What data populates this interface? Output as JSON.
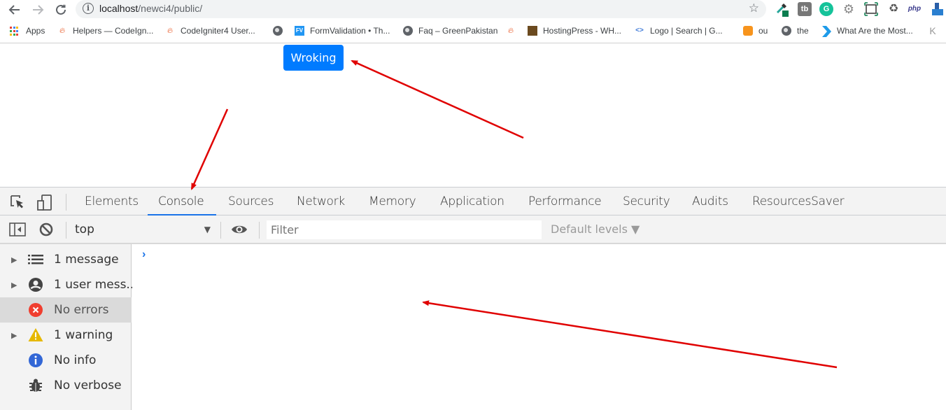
{
  "browser": {
    "url_host": "localhost",
    "url_path": "/newci4/public/",
    "nav": {
      "back": "back-icon",
      "forward": "forward-icon",
      "reload": "reload-icon"
    },
    "extensions": [
      "eyedropper-extension",
      "tb-extension",
      "grammarly-extension",
      "gear-extension",
      "screenshot-extension",
      "recycle-extension",
      "php-extension",
      "user-extension"
    ],
    "ext_labels": {
      "tb": "tb",
      "grammarly": "G",
      "php": "php"
    },
    "bookmarks": [
      {
        "label": "Apps",
        "icon": "apps-grid-icon"
      },
      {
        "label": "Helpers — CodeIgn...",
        "icon": "codeigniter-flame-icon"
      },
      {
        "label": "CodeIgniter4 User...",
        "icon": "codeigniter-flame-icon"
      },
      {
        "label": "",
        "icon": "globe-icon"
      },
      {
        "label": "FormValidation • Th...",
        "icon": "fv-icon",
        "badge": "FV"
      },
      {
        "label": "Faq – GreenPakistan",
        "icon": "globe-icon"
      },
      {
        "label": "",
        "icon": "codeigniter-flame-icon"
      },
      {
        "label": "HostingPress - WH...",
        "icon": "hostingpress-icon"
      },
      {
        "label": "Logo | Search | G...",
        "icon": "code-brackets-icon",
        "badge": "<>"
      },
      {
        "label": "ou",
        "icon": "orange-cube-icon"
      },
      {
        "label": "the",
        "icon": "globe-icon"
      },
      {
        "label": "What Are the Most...",
        "icon": "chevron-bookmark-icon"
      },
      {
        "label": "",
        "icon": "k-logo-icon"
      }
    ]
  },
  "page": {
    "button_label": "Wroking",
    "button_color": "#007bff"
  },
  "devtools": {
    "tabs": [
      {
        "label": "Elements"
      },
      {
        "label": "Console",
        "active": true
      },
      {
        "label": "Sources"
      },
      {
        "label": "Network"
      },
      {
        "label": "Memory"
      },
      {
        "label": "Application"
      },
      {
        "label": "Performance"
      },
      {
        "label": "Security"
      },
      {
        "label": "Audits"
      },
      {
        "label": "ResourcesSaver"
      }
    ],
    "toolbar": {
      "context": "top",
      "filter_placeholder": "Filter",
      "filter_value": "",
      "levels": "Default levels ▼"
    },
    "sidebar": [
      {
        "label": "1 message",
        "icon": "list-icon",
        "expandable": true
      },
      {
        "label": "1 user mess...",
        "icon": "user-icon",
        "expandable": true
      },
      {
        "label": "No errors",
        "icon": "error-icon",
        "expandable": false,
        "selected": true
      },
      {
        "label": "1 warning",
        "icon": "warning-icon",
        "expandable": true
      },
      {
        "label": "No info",
        "icon": "info-icon",
        "expandable": false
      },
      {
        "label": "No verbose",
        "icon": "bug-icon",
        "expandable": false
      }
    ],
    "prompt": "›"
  },
  "colors": {
    "accent": "#1a73e8",
    "error": "#f03e2f",
    "warning": "#e6b800",
    "info": "#3367d6",
    "annotation": "#e00000"
  }
}
